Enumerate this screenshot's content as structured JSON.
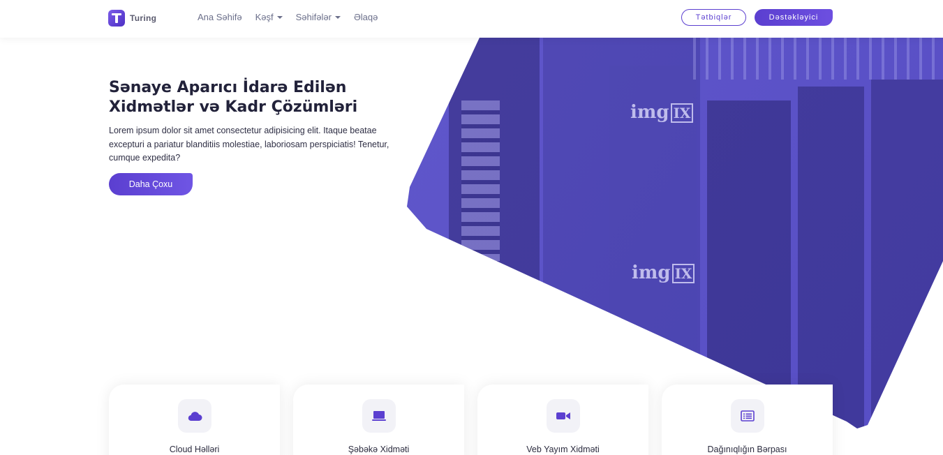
{
  "navbar": {
    "brand": "Turing",
    "links": [
      {
        "label": "Ana Səhifə",
        "dropdown": false
      },
      {
        "label": "Kəşf",
        "dropdown": true
      },
      {
        "label": "Səhifələr",
        "dropdown": true
      },
      {
        "label": "Əlaqə",
        "dropdown": false
      }
    ],
    "outline_button": "Tətbiqlər",
    "solid_button": "Dəstəkləyici"
  },
  "hero": {
    "title": "Sənaye Aparıcı İdarə Edilən Xidmətlər və Kadr Çözümləri",
    "text": "Lorem ipsum dolor sit amet consectetur adipisicing elit. Itaque beatae excepturi a pariatur blanditiis molestiae, laboriosam perspiciatis! Tenetur, cumque expedita?",
    "button": "Daha Çoxu",
    "image_brand_1": "img",
    "image_brand_2": "IX"
  },
  "services": [
    {
      "label": "Cloud Həlləri",
      "icon": "cloud-icon"
    },
    {
      "label": "Şəbəkə Xidməti",
      "icon": "laptop-icon"
    },
    {
      "label": "Veb Yayım Xidməti",
      "icon": "video-camera-icon"
    },
    {
      "label": "Dağınıqlığın Bərpası",
      "icon": "list-icon"
    }
  ],
  "colors": {
    "accent": "#5b3fd0",
    "hero_overlay": "#5d54c7",
    "text_dark": "#22223a"
  }
}
